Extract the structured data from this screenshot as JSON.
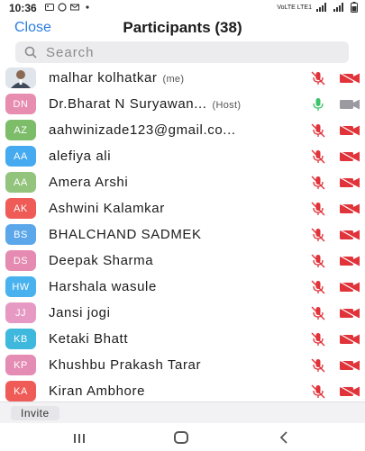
{
  "status_bar": {
    "time": "10:36",
    "network_label": "VoLTE LTE1",
    "battery_icon": "battery-icon"
  },
  "header": {
    "close_label": "Close",
    "title": "Participants (38)"
  },
  "search": {
    "placeholder": "Search"
  },
  "colors": {
    "accent": "#2a7ee0",
    "mic_off": "#e0333a",
    "mic_on": "#3cc36a",
    "cam_off": "#e0333a",
    "cam_on_gray": "#9a9aa0"
  },
  "participants": [
    {
      "initials": "",
      "avatar": "photo",
      "name": "malhar kolhatkar",
      "tag": "(me)",
      "color": "#dfe5ea",
      "mic": "off",
      "cam": "off"
    },
    {
      "initials": "DN",
      "name": "Dr.Bharat N Suryawan...",
      "tag": "(Host)",
      "color": "#e68db0",
      "mic": "on",
      "cam": "gray"
    },
    {
      "initials": "AZ",
      "name": "aahwinizade123@gmail.co...",
      "tag": "",
      "color": "#7dbd6a",
      "mic": "off",
      "cam": "off"
    },
    {
      "initials": "AA",
      "name": "alefiya ali",
      "tag": "",
      "color": "#45aaf0",
      "mic": "off",
      "cam": "off"
    },
    {
      "initials": "AA",
      "name": "Amera Arshi",
      "tag": "",
      "color": "#93c47d",
      "mic": "off",
      "cam": "off"
    },
    {
      "initials": "AK",
      "name": "Ashwini Kalamkar",
      "tag": "",
      "color": "#ef5b57",
      "mic": "off",
      "cam": "off"
    },
    {
      "initials": "BS",
      "name": "BHALCHAND SADMEK",
      "tag": "",
      "color": "#5ba7ea",
      "mic": "off",
      "cam": "off"
    },
    {
      "initials": "DS",
      "name": "Deepak Sharma",
      "tag": "",
      "color": "#e58ab0",
      "mic": "off",
      "cam": "off"
    },
    {
      "initials": "HW",
      "name": "Harshala wasule",
      "tag": "",
      "color": "#49b2ee",
      "mic": "off",
      "cam": "off"
    },
    {
      "initials": "JJ",
      "name": "Jansi jogi",
      "tag": "",
      "color": "#e69ac3",
      "mic": "off",
      "cam": "off"
    },
    {
      "initials": "KB",
      "name": "Ketaki Bhatt",
      "tag": "",
      "color": "#3fb8dd",
      "mic": "off",
      "cam": "off"
    },
    {
      "initials": "KP",
      "name": "Khushbu Prakash Tarar",
      "tag": "",
      "color": "#e48cb4",
      "mic": "off",
      "cam": "off"
    },
    {
      "initials": "KA",
      "name": "Kiran Ambhore",
      "tag": "",
      "color": "#ef5b57",
      "mic": "off",
      "cam": "off"
    }
  ],
  "footer": {
    "invite_label": "Invite"
  }
}
